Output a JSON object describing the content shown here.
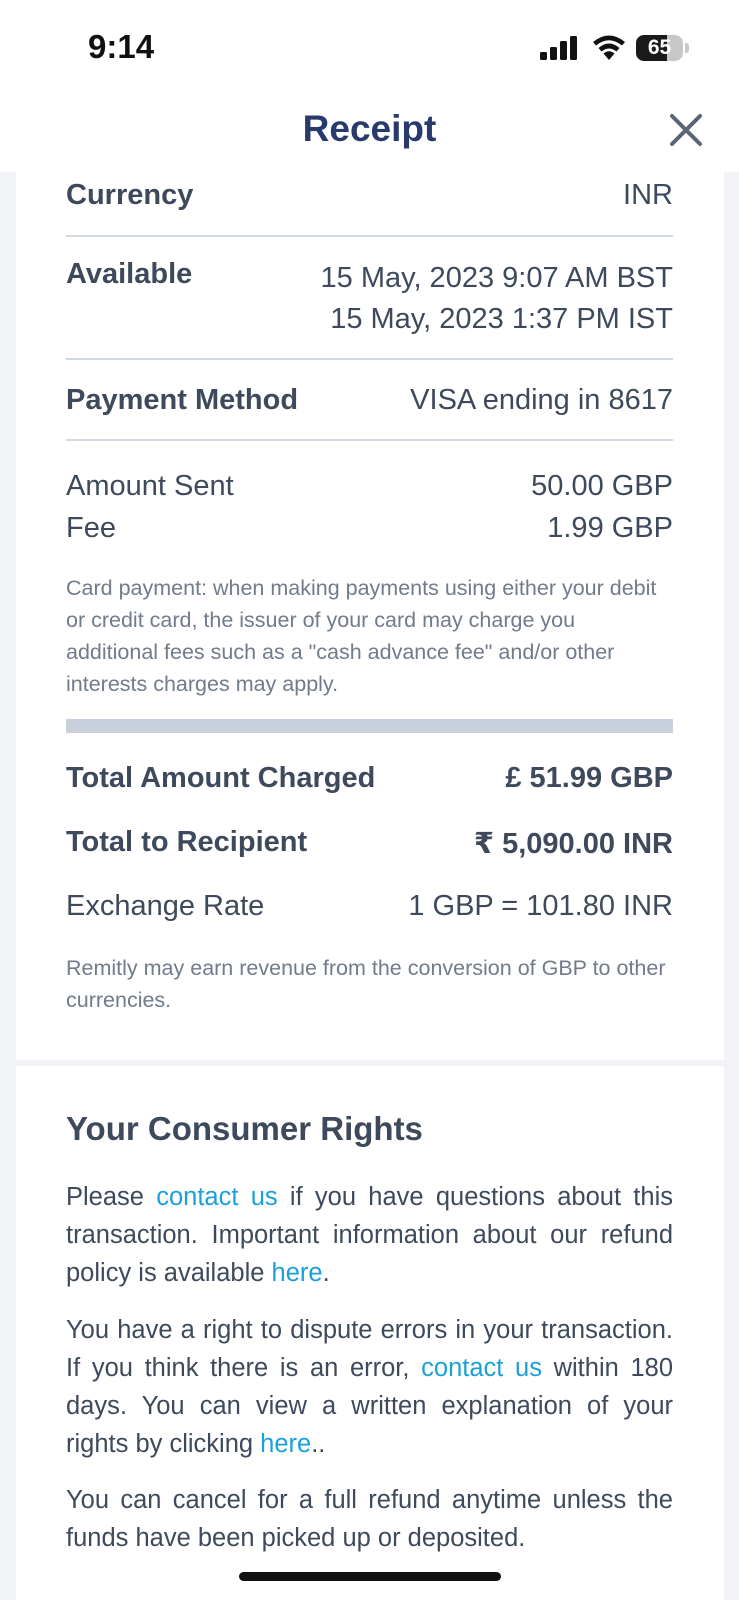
{
  "status_bar": {
    "time": "9:14",
    "battery": "65",
    "battery_level": 0.65
  },
  "header": {
    "title": "Receipt"
  },
  "details": {
    "currency_label": "Currency",
    "currency_value": "INR",
    "available_label": "Available",
    "available_bst": "15 May, 2023 9:07 AM BST",
    "available_ist": "15 May, 2023 1:37 PM IST",
    "payment_method_label": "Payment Method",
    "payment_method_value": "VISA ending in 8617",
    "amount_sent_label": "Amount Sent",
    "amount_sent_value": "50.00 GBP",
    "fee_label": "Fee",
    "fee_value": "1.99 GBP",
    "card_note": "Card payment: when making payments using either your debit or credit card, the issuer of your card may charge you additional fees such as a \"cash advance fee\" and/or other interests charges may apply."
  },
  "totals": {
    "total_charged_label": "Total Amount Charged",
    "total_charged_value": "£ 51.99 GBP",
    "total_recipient_label": "Total to Recipient",
    "total_recipient_value": "₹ 5,090.00 INR",
    "exchange_rate_label": "Exchange Rate",
    "exchange_rate_value": "1 GBP = 101.80 INR",
    "revenue_note": "Remitly may earn revenue from the conversion of GBP to other currencies."
  },
  "rights": {
    "title": "Your Consumer Rights",
    "p1_a": "Please ",
    "p1_link1": "contact us",
    "p1_b": " if you have questions about this transaction. Important information about our refund policy is available ",
    "p1_link2": "here",
    "p1_c": ".",
    "p2_a": "You have a right to dispute errors in your transaction. If you think there is an error, ",
    "p2_link1": "contact us",
    "p2_b": " within 180 days. You can view a written explanation of your rights by clicking ",
    "p2_link2": "here",
    "p2_c": "..",
    "p3": "You can cancel for a full refund anytime unless the funds have been picked up or deposited."
  },
  "colors": {
    "accent_link": "#1ba0d8",
    "title_navy": "#283a6b",
    "text": "#3e4a5c"
  }
}
